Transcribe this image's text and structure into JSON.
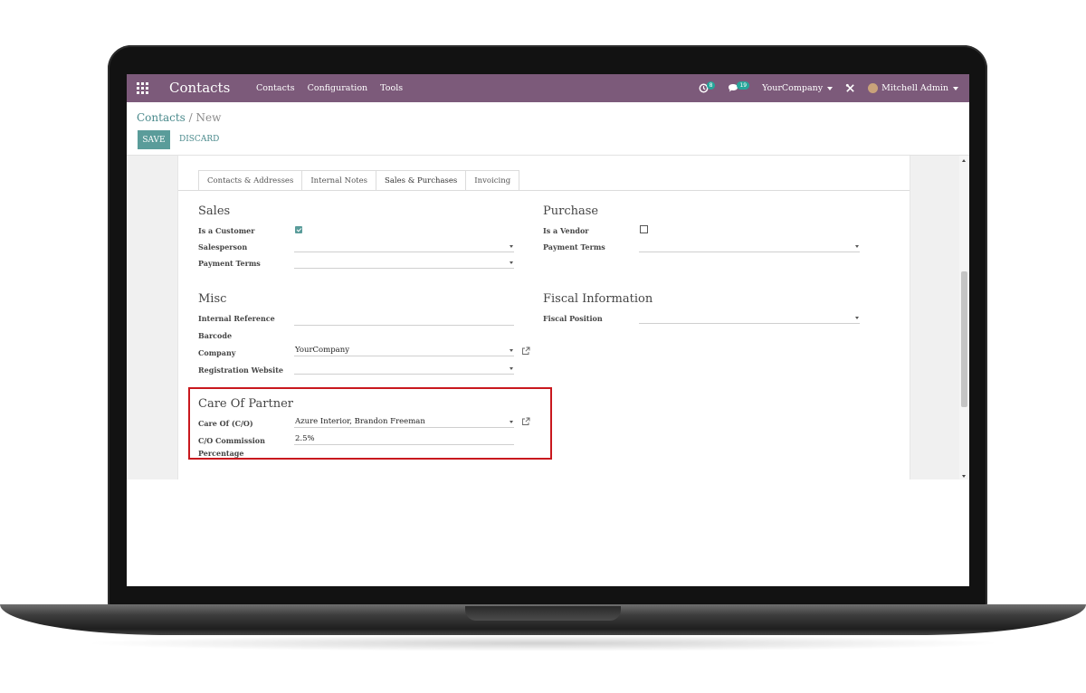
{
  "navbar": {
    "brand": "Contacts",
    "menu": [
      "Contacts",
      "Configuration",
      "Tools"
    ],
    "activity_count": "8",
    "message_count": "19",
    "company": "YourCompany",
    "user": "Mitchell Admin"
  },
  "breadcrumb": {
    "root": "Contacts",
    "separator": " / ",
    "current": "New"
  },
  "buttons": {
    "save": "SAVE",
    "discard": "DISCARD"
  },
  "tabs": [
    "Contacts & Addresses",
    "Internal Notes",
    "Sales & Purchases",
    "Invoicing"
  ],
  "active_tab": "Sales & Purchases",
  "sales": {
    "title": "Sales",
    "is_customer_label": "Is a Customer",
    "is_customer": true,
    "salesperson_label": "Salesperson",
    "salesperson_value": "",
    "payment_terms_label": "Payment Terms",
    "payment_terms_value": ""
  },
  "purchase": {
    "title": "Purchase",
    "is_vendor_label": "Is a Vendor",
    "is_vendor": false,
    "payment_terms_label": "Payment Terms",
    "payment_terms_value": ""
  },
  "misc": {
    "title": "Misc",
    "internal_reference_label": "Internal Reference",
    "internal_reference_value": "",
    "barcode_label": "Barcode",
    "company_label": "Company",
    "company_value": "YourCompany",
    "registration_website_label": "Registration Website",
    "registration_website_value": ""
  },
  "fiscal": {
    "title": "Fiscal Information",
    "fiscal_position_label": "Fiscal Position",
    "fiscal_position_value": ""
  },
  "care_of": {
    "title": "Care Of Partner",
    "care_of_label": "Care Of (C/O)",
    "care_of_value": "Azure Interior, Brandon Freeman",
    "commission_label_line1": "C/O Commission",
    "commission_label_line2": "Percentage",
    "commission_value": "2.5%"
  },
  "colors": {
    "navbar": "#7c5a7a",
    "primary": "#5a9c9a",
    "highlight": "#c9181e"
  }
}
